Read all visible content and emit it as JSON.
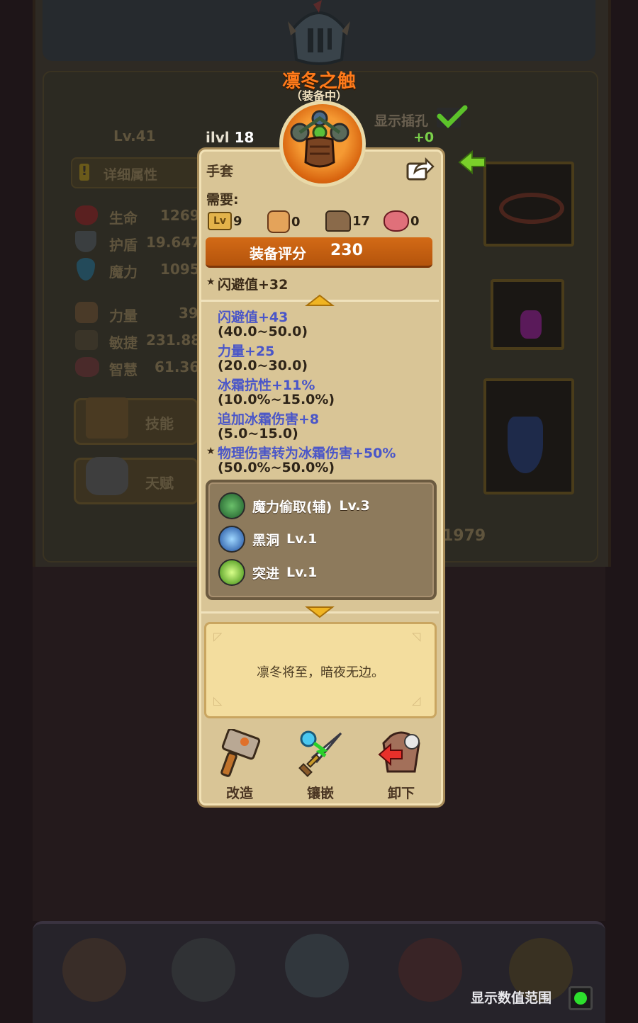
{
  "item": {
    "name": "凛冬之触",
    "status": "（装备中）",
    "ilvl_label": "ilvl",
    "ilvl_value": "18",
    "slot": "手套",
    "requirements_label": "需要:",
    "requirements": [
      {
        "icon": "level-icon",
        "value": "9"
      },
      {
        "icon": "strength-fist-icon",
        "value": "0"
      },
      {
        "icon": "agility-boot-icon",
        "value": "17"
      },
      {
        "icon": "wisdom-brain-icon",
        "value": "0"
      }
    ],
    "score_label": "装备评分",
    "score_value": "230",
    "base_stat": "闪避值+32",
    "affixes": [
      {
        "text": "闪避值+43",
        "range": "(40.0~50.0)",
        "starred": false
      },
      {
        "text": "力量+25",
        "range": "(20.0~30.0)",
        "starred": false
      },
      {
        "text": "冰霜抗性+11%",
        "range": "(10.0%~15.0%)",
        "starred": false
      },
      {
        "text": "追加冰霜伤害+8",
        "range": "(5.0~15.0)",
        "starred": false
      },
      {
        "text": "物理伤害转为冰霜伤害+50%",
        "range": "(50.0%~50.0%)",
        "starred": true
      }
    ],
    "skills": [
      {
        "name": "魔力偷取(辅)",
        "level": "Lv.3",
        "color": "#3aa04a"
      },
      {
        "name": "黑洞",
        "level": "Lv.1",
        "color": "#2a7bd0"
      },
      {
        "name": "突进",
        "level": "Lv.1",
        "color": "#5ac82a"
      }
    ],
    "flavor": "凛冬将至，暗夜无边。"
  },
  "actions": [
    {
      "label": "改造",
      "icon": "hammer-icon"
    },
    {
      "label": "镶嵌",
      "icon": "socket-sword-icon"
    },
    {
      "label": "卸下",
      "icon": "unequip-armor-icon"
    }
  ],
  "socket_toggle": {
    "label": "显示插孔",
    "bonus": "+0"
  },
  "background": {
    "level": "Lv.41",
    "detail_button": "详细属性",
    "stats": [
      {
        "label": "生命",
        "value": "1269"
      },
      {
        "label": "护盾",
        "value": "19.647"
      },
      {
        "label": "魔力",
        "value": "1095"
      },
      {
        "label": "力量",
        "value": "39"
      },
      {
        "label": "敏捷",
        "value": "231.88"
      },
      {
        "label": "智慧",
        "value": "61.36"
      }
    ],
    "skill_button": "技能",
    "talent_button": "天赋",
    "power_value": "1979"
  },
  "footer": {
    "range_label": "显示数值范围",
    "range_enabled": true
  },
  "colors": {
    "accent": "#d36a16",
    "affix_blue": "#4a56c8",
    "name_orange": "#ff7a1a",
    "toggle_on": "#2de02d"
  }
}
